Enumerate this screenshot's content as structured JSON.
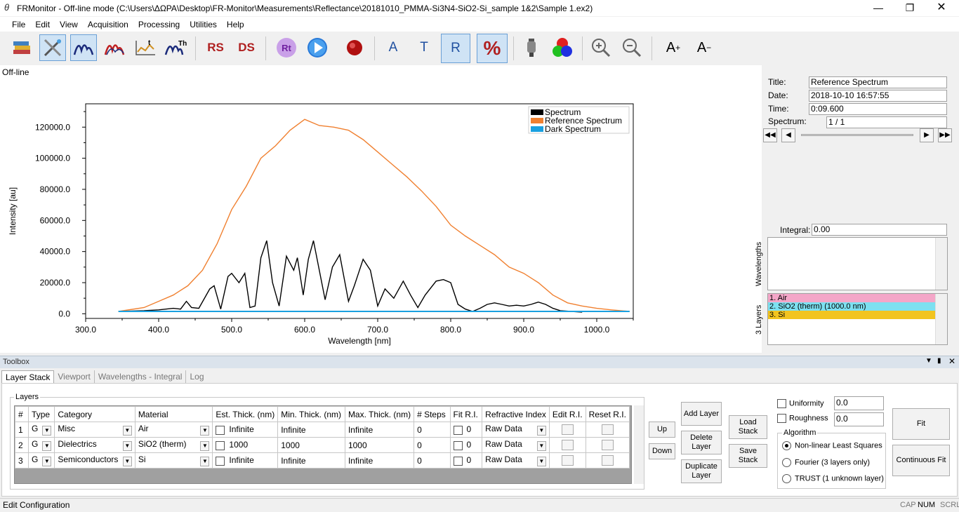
{
  "window": {
    "title": "FRMonitor - Off-line mode (C:\\Users\\ΔΩΡΑ\\Desktop\\FR-Monitor\\Measurements\\Reflectance\\20181010_PMMA-Si3N4-SiO2-Si_sample 1&2\\Sample 1.ex2)"
  },
  "menu": [
    "File",
    "Edit",
    "View",
    "Acquisition",
    "Processing",
    "Utilities",
    "Help"
  ],
  "toolbar": {
    "rs": "RS",
    "ds": "DS",
    "rt": "Rt",
    "a": "A",
    "t": "T",
    "r": "R",
    "pct": "%",
    "aplus": "A",
    "aplus_sup": "+",
    "aminus": "A",
    "aminus_sup": "−",
    "th_sup": "Th",
    "t_sup": "t"
  },
  "mode_label": "Off-line",
  "info": {
    "title_label": "Title:",
    "title_value": "Reference Spectrum",
    "date_label": "Date:",
    "date_value": "2018-10-10 16:57:55",
    "time_label": "Time:",
    "time_value": "0:09.600",
    "spectrum_label": "Spectrum:",
    "spectrum_value": "1 / 1",
    "integral_label": "Integral:",
    "integral_value": "0.00",
    "wavelengths_label": "Wavelengths",
    "layers_label": "3 Layers"
  },
  "layer_list": [
    {
      "text": "1. Air",
      "color": "#f4a6c8"
    },
    {
      "text": "2. SiO2 (therm) (1000.0 nm)",
      "color": "#7de0f0"
    },
    {
      "text": "3. Si",
      "color": "#f2c41f"
    }
  ],
  "chart_data": {
    "type": "line",
    "xlabel": "Wavelength [nm]",
    "ylabel": "Intensity [au]",
    "xlim": [
      300,
      1050
    ],
    "ylim": [
      -3000,
      135000
    ],
    "xticks": [
      "300.0",
      "400.0",
      "500.0",
      "600.0",
      "700.0",
      "800.0",
      "900.0",
      "1000.0"
    ],
    "yticks": [
      "0.0",
      "20000.0",
      "40000.0",
      "60000.0",
      "80000.0",
      "100000.0",
      "120000.0"
    ],
    "legend_position": "top-right",
    "series": [
      {
        "name": "Spectrum",
        "color": "#000000",
        "x": [
          345,
          380,
          400,
          420,
          430,
          438,
          445,
          455,
          470,
          476,
          485,
          495,
          500,
          510,
          518,
          525,
          532,
          540,
          548,
          556,
          565,
          575,
          585,
          590,
          598,
          605,
          612,
          620,
          628,
          638,
          648,
          660,
          668,
          680,
          690,
          700,
          710,
          722,
          735,
          745,
          755,
          765,
          780,
          790,
          800,
          810,
          820,
          830,
          840,
          850,
          860,
          870,
          880,
          890,
          900,
          910,
          920,
          930,
          940,
          950,
          965,
          980
        ],
        "y": [
          1500,
          2000,
          2500,
          3500,
          3000,
          8000,
          4000,
          3500,
          16000,
          18000,
          3000,
          24000,
          26000,
          20000,
          26000,
          4000,
          5000,
          36000,
          47000,
          20000,
          5000,
          37000,
          28000,
          36000,
          12000,
          35000,
          47000,
          28000,
          9000,
          30000,
          38000,
          8000,
          18000,
          35000,
          28000,
          5000,
          16000,
          10000,
          21000,
          12000,
          4000,
          12000,
          21000,
          22000,
          20000,
          6000,
          3000,
          1500,
          3500,
          6000,
          7000,
          6000,
          5000,
          5500,
          5000,
          6000,
          7500,
          6000,
          3500,
          2000,
          1500,
          1000
        ]
      },
      {
        "name": "Reference Spectrum",
        "color": "#f08030",
        "x": [
          345,
          380,
          400,
          420,
          440,
          460,
          480,
          500,
          520,
          540,
          560,
          580,
          600,
          620,
          640,
          660,
          680,
          700,
          720,
          740,
          760,
          780,
          800,
          820,
          840,
          860,
          880,
          900,
          920,
          940,
          960,
          980,
          1000,
          1020,
          1045
        ],
        "y": [
          1500,
          4000,
          8000,
          12000,
          18000,
          28000,
          45000,
          67000,
          82000,
          100000,
          108000,
          118000,
          125000,
          121000,
          120000,
          118000,
          112000,
          104000,
          96000,
          88000,
          79000,
          69000,
          57000,
          50000,
          44000,
          38000,
          30000,
          26000,
          20000,
          12000,
          7000,
          5000,
          3500,
          2500,
          1500
        ]
      },
      {
        "name": "Dark Spectrum",
        "color": "#1aa0e0",
        "x": [
          345,
          1045
        ],
        "y": [
          1500,
          1500
        ]
      }
    ]
  },
  "toolbox": {
    "title": "Toolbox",
    "tabs": [
      "Layer Stack",
      "Viewport",
      "Wavelengths - Integral",
      "Log"
    ],
    "layers_group": "Layers",
    "headers": [
      "#",
      "Type",
      "Category",
      "Material",
      "Est. Thick. (nm)",
      "Min. Thick. (nm)",
      "Max. Thick. (nm)",
      "# Steps",
      "Fit R.I.",
      "Refractive Index",
      "Edit R.I.",
      "Reset R.I."
    ],
    "rows": [
      {
        "num": "1",
        "type": "G",
        "category": "Misc",
        "material": "Air",
        "est": "Infinite",
        "min": "Infinite",
        "max": "Infinite",
        "steps": "0",
        "fit": "0",
        "ri": "Raw Data"
      },
      {
        "num": "2",
        "type": "G",
        "category": "Dielectrics",
        "material": "SiO2 (therm)",
        "est": "1000",
        "min": "1000",
        "max": "1000",
        "steps": "0",
        "fit": "0",
        "ri": "Raw Data"
      },
      {
        "num": "3",
        "type": "G",
        "category": "Semiconductors",
        "material": "Si",
        "est": "Infinite",
        "min": "Infinite",
        "max": "Infinite",
        "steps": "0",
        "fit": "0",
        "ri": "Raw Data"
      }
    ],
    "up": "Up",
    "down": "Down",
    "add_layer": "Add Layer",
    "delete_layer": "Delete Layer",
    "duplicate_layer": "Duplicate Layer",
    "load_stack": "Load Stack",
    "save_stack": "Save Stack",
    "uniformity_label": "Uniformity",
    "uniformity_value": "0.0",
    "roughness_label": "Roughness",
    "roughness_value": "0.0",
    "algorithm_label": "Algorithm",
    "algorithms": [
      "Non-linear Least Squares",
      "Fourier (3 layers only)",
      "TRUST (1 unknown layer)"
    ],
    "fit": "Fit",
    "continuous_fit": "Continuous Fit"
  },
  "status": {
    "left": "Edit Configuration",
    "cap": "CAP",
    "num": "NUM",
    "scrl": "SCRL"
  }
}
